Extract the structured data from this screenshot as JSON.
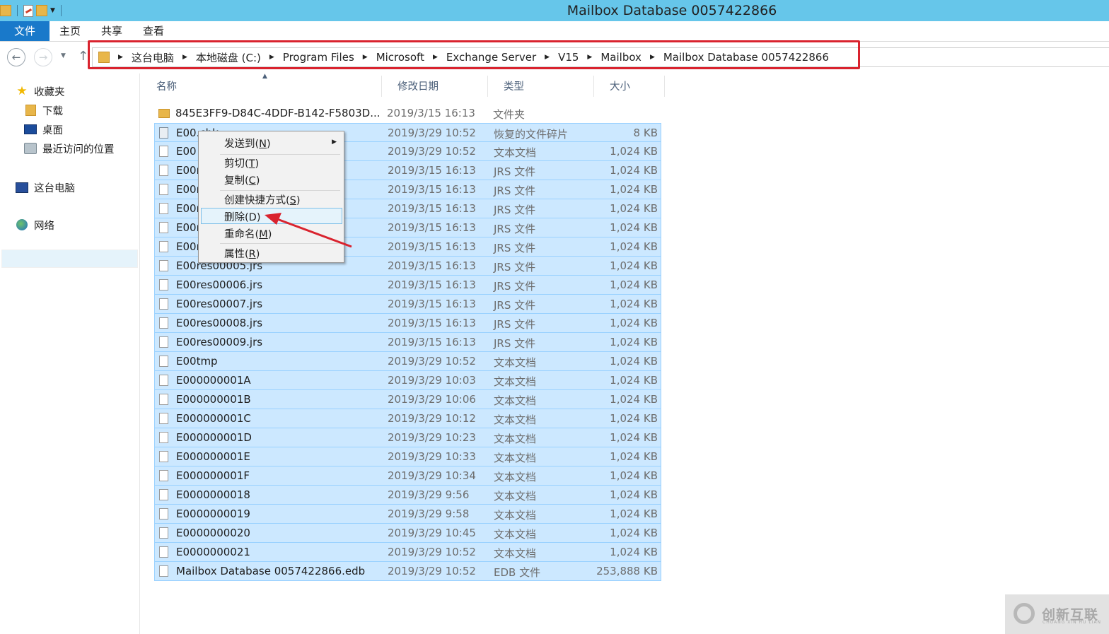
{
  "window": {
    "title": "Mailbox Database 0057422866"
  },
  "ribbon": {
    "tabs": [
      "文件",
      "主页",
      "共享",
      "查看"
    ]
  },
  "address": {
    "crumbs": [
      "这台电脑",
      "本地磁盘 (C:)",
      "Program Files",
      "Microsoft",
      "Exchange Server",
      "V15",
      "Mailbox",
      "Mailbox Database 0057422866"
    ]
  },
  "sidebar": {
    "favorites": "收藏夹",
    "downloads": "下载",
    "desktop": "桌面",
    "recent": "最近访问的位置",
    "this_pc": "这台电脑",
    "network": "网络"
  },
  "columns": {
    "name": "名称",
    "date": "修改日期",
    "type": "类型",
    "size": "大小"
  },
  "files": [
    {
      "name": "845E3FF9-D84C-4DDF-B142-F5803D...",
      "date": "2019/3/15 16:13",
      "type": "文件夹",
      "size": "",
      "kind": "folder",
      "selected": false
    },
    {
      "name": "E00.chk",
      "date": "2019/3/29 10:52",
      "type": "恢复的文件碎片",
      "size": "8 KB",
      "kind": "frag",
      "selected": true
    },
    {
      "name": "E00",
      "date": "2019/3/29 10:52",
      "type": "文本文档",
      "size": "1,024 KB",
      "kind": "file",
      "selected": true
    },
    {
      "name": "E00res00000.jrs",
      "date": "2019/3/15 16:13",
      "type": "JRS 文件",
      "size": "1,024 KB",
      "kind": "file",
      "selected": true
    },
    {
      "name": "E00res00001.jrs",
      "date": "2019/3/15 16:13",
      "type": "JRS 文件",
      "size": "1,024 KB",
      "kind": "file",
      "selected": true
    },
    {
      "name": "E00res00002.jrs",
      "date": "2019/3/15 16:13",
      "type": "JRS 文件",
      "size": "1,024 KB",
      "kind": "file",
      "selected": true
    },
    {
      "name": "E00res00003.jrs",
      "date": "2019/3/15 16:13",
      "type": "JRS 文件",
      "size": "1,024 KB",
      "kind": "file",
      "selected": true
    },
    {
      "name": "E00res00004.jrs",
      "date": "2019/3/15 16:13",
      "type": "JRS 文件",
      "size": "1,024 KB",
      "kind": "file",
      "selected": true
    },
    {
      "name": "E00res00005.jrs",
      "date": "2019/3/15 16:13",
      "type": "JRS 文件",
      "size": "1,024 KB",
      "kind": "file",
      "selected": true
    },
    {
      "name": "E00res00006.jrs",
      "date": "2019/3/15 16:13",
      "type": "JRS 文件",
      "size": "1,024 KB",
      "kind": "file",
      "selected": true
    },
    {
      "name": "E00res00007.jrs",
      "date": "2019/3/15 16:13",
      "type": "JRS 文件",
      "size": "1,024 KB",
      "kind": "file",
      "selected": true
    },
    {
      "name": "E00res00008.jrs",
      "date": "2019/3/15 16:13",
      "type": "JRS 文件",
      "size": "1,024 KB",
      "kind": "file",
      "selected": true
    },
    {
      "name": "E00res00009.jrs",
      "date": "2019/3/15 16:13",
      "type": "JRS 文件",
      "size": "1,024 KB",
      "kind": "file",
      "selected": true
    },
    {
      "name": "E00tmp",
      "date": "2019/3/29 10:52",
      "type": "文本文档",
      "size": "1,024 KB",
      "kind": "file",
      "selected": true
    },
    {
      "name": "E000000001A",
      "date": "2019/3/29 10:03",
      "type": "文本文档",
      "size": "1,024 KB",
      "kind": "file",
      "selected": true
    },
    {
      "name": "E000000001B",
      "date": "2019/3/29 10:06",
      "type": "文本文档",
      "size": "1,024 KB",
      "kind": "file",
      "selected": true
    },
    {
      "name": "E000000001C",
      "date": "2019/3/29 10:12",
      "type": "文本文档",
      "size": "1,024 KB",
      "kind": "file",
      "selected": true
    },
    {
      "name": "E000000001D",
      "date": "2019/3/29 10:23",
      "type": "文本文档",
      "size": "1,024 KB",
      "kind": "file",
      "selected": true
    },
    {
      "name": "E000000001E",
      "date": "2019/3/29 10:33",
      "type": "文本文档",
      "size": "1,024 KB",
      "kind": "file",
      "selected": true
    },
    {
      "name": "E000000001F",
      "date": "2019/3/29 10:34",
      "type": "文本文档",
      "size": "1,024 KB",
      "kind": "file",
      "selected": true
    },
    {
      "name": "E0000000018",
      "date": "2019/3/29 9:56",
      "type": "文本文档",
      "size": "1,024 KB",
      "kind": "file",
      "selected": true
    },
    {
      "name": "E0000000019",
      "date": "2019/3/29 9:58",
      "type": "文本文档",
      "size": "1,024 KB",
      "kind": "file",
      "selected": true
    },
    {
      "name": "E0000000020",
      "date": "2019/3/29 10:45",
      "type": "文本文档",
      "size": "1,024 KB",
      "kind": "file",
      "selected": true
    },
    {
      "name": "E0000000021",
      "date": "2019/3/29 10:52",
      "type": "文本文档",
      "size": "1,024 KB",
      "kind": "file",
      "selected": true
    },
    {
      "name": "Mailbox Database 0057422866.edb",
      "date": "2019/3/29 10:52",
      "type": "EDB 文件",
      "size": "253,888 KB",
      "kind": "file",
      "selected": true
    }
  ],
  "context_menu": {
    "send_to": "发送到(",
    "send_to_key": "N",
    "cut": "剪切(",
    "cut_key": "T",
    "copy": "复制(",
    "copy_key": "C",
    "shortcut": "创建快捷方式(",
    "shortcut_key": "S",
    "delete": "删除(D)",
    "rename": "重命名(",
    "rename_key": "M",
    "properties": "属性(",
    "properties_key": "R",
    "close_paren": ")"
  },
  "watermark": {
    "brand": "创新互联",
    "sub": "CHUANG XIN HU LIAN"
  },
  "colors": {
    "titlebar": "#66c6ea",
    "file_tab": "#1979ca",
    "selection": "#cce8ff",
    "annotation": "#d9232e"
  }
}
